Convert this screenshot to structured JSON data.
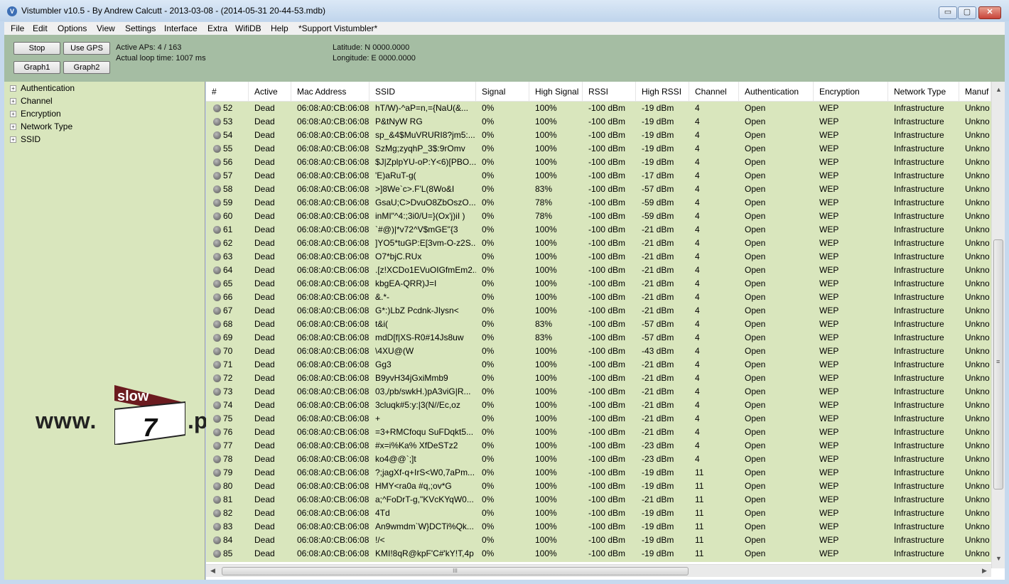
{
  "window": {
    "title": "Vistumbler v10.5 - By Andrew Calcutt - 2013-03-08 - (2014-05-31 20-44-53.mdb)",
    "controls": {
      "minimize": "▭",
      "maximize": "▢",
      "close": "✕"
    }
  },
  "menu": [
    "File",
    "Edit",
    "Options",
    "View",
    "Settings",
    "Interface",
    "Extra",
    "WifiDB",
    "Help",
    "*Support Vistumbler*"
  ],
  "toolbar": {
    "stop": "Stop",
    "use_gps": "Use GPS",
    "graph1": "Graph1",
    "graph2": "Graph2",
    "active_aps": "Active APs: 4 / 163",
    "loop_time": "Actual loop time: 1007 ms",
    "latitude": "Latitude: N 0000.0000",
    "longitude": "Longitude: E 0000.0000"
  },
  "tree": {
    "items": [
      "Authentication",
      "Channel",
      "Encryption",
      "Network Type",
      "SSID"
    ],
    "expander": "+"
  },
  "logo": {
    "prefix": "www.",
    "top": "slow",
    "number": "7",
    "suffix": ".pl"
  },
  "columns": [
    "#",
    "Active",
    "Mac Address",
    "SSID",
    "Signal",
    "High Signal",
    "RSSI",
    "High RSSI",
    "Channel",
    "Authentication",
    "Encryption",
    "Network Type",
    "Manuf"
  ],
  "rows": [
    [
      "52",
      "Dead",
      "06:08:A0:CB:06:08",
      "hT/W)-^aP=n,={NaU(&...",
      "0%",
      "100%",
      "-100 dBm",
      "-19 dBm",
      "4",
      "Open",
      "WEP",
      "Infrastructure",
      "Unkno"
    ],
    [
      "53",
      "Dead",
      "06:08:A0:CB:06:08",
      "P&tNyW RG",
      "0%",
      "100%",
      "-100 dBm",
      "-19 dBm",
      "4",
      "Open",
      "WEP",
      "Infrastructure",
      "Unkno"
    ],
    [
      "54",
      "Dead",
      "06:08:A0:CB:06:08",
      "sp_&4$MuVRURI8?jm5:...",
      "0%",
      "100%",
      "-100 dBm",
      "-19 dBm",
      "4",
      "Open",
      "WEP",
      "Infrastructure",
      "Unkno"
    ],
    [
      "55",
      "Dead",
      "06:08:A0:CB:06:08",
      "SzMg;zyqhP_3$:9rOmv",
      "0%",
      "100%",
      "-100 dBm",
      "-19 dBm",
      "4",
      "Open",
      "WEP",
      "Infrastructure",
      "Unkno"
    ],
    [
      "56",
      "Dead",
      "06:08:A0:CB:06:08",
      "$J|ZplpYU-oP:Y<6)[PBO...",
      "0%",
      "100%",
      "-100 dBm",
      "-19 dBm",
      "4",
      "Open",
      "WEP",
      "Infrastructure",
      "Unkno"
    ],
    [
      "57",
      "Dead",
      "06:08:A0:CB:06:08",
      "'E)aRuT-g(",
      "0%",
      "100%",
      "-100 dBm",
      "-17 dBm",
      "4",
      "Open",
      "WEP",
      "Infrastructure",
      "Unkno"
    ],
    [
      "58",
      "Dead",
      "06:08:A0:CB:06:08",
      ">]8We`c>.F'L(8Wo&I",
      "0%",
      "83%",
      "-100 dBm",
      "-57 dBm",
      "4",
      "Open",
      "WEP",
      "Infrastructure",
      "Unkno"
    ],
    [
      "59",
      "Dead",
      "06:08:A0:CB:06:08",
      "GsaU;C>DvuO8ZbOszO...",
      "0%",
      "78%",
      "-100 dBm",
      "-59 dBm",
      "4",
      "Open",
      "WEP",
      "Infrastructure",
      "Unkno"
    ],
    [
      "60",
      "Dead",
      "06:08:A0:CB:06:08",
      "inMI\"^4:;3i0/U=}(Ox'j)iI )",
      "0%",
      "78%",
      "-100 dBm",
      "-59 dBm",
      "4",
      "Open",
      "WEP",
      "Infrastructure",
      "Unkno"
    ],
    [
      "61",
      "Dead",
      "06:08:A0:CB:06:08",
      "`#@)|*v72^V$mGE\"{3",
      "0%",
      "100%",
      "-100 dBm",
      "-21 dBm",
      "4",
      "Open",
      "WEP",
      "Infrastructure",
      "Unkno"
    ],
    [
      "62",
      "Dead",
      "06:08:A0:CB:06:08",
      "]YO5*tuGP:E[3vm-O-z2S...",
      "0%",
      "100%",
      "-100 dBm",
      "-21 dBm",
      "4",
      "Open",
      "WEP",
      "Infrastructure",
      "Unkno"
    ],
    [
      "63",
      "Dead",
      "06:08:A0:CB:06:08",
      "O7*bjC.RUx",
      "0%",
      "100%",
      "-100 dBm",
      "-21 dBm",
      "4",
      "Open",
      "WEP",
      "Infrastructure",
      "Unkno"
    ],
    [
      "64",
      "Dead",
      "06:08:A0:CB:06:08",
      ".[z!XCDo1EVuOIGfmEm2...",
      "0%",
      "100%",
      "-100 dBm",
      "-21 dBm",
      "4",
      "Open",
      "WEP",
      "Infrastructure",
      "Unkno"
    ],
    [
      "65",
      "Dead",
      "06:08:A0:CB:06:08",
      "kbgEA-QRR)J=I",
      "0%",
      "100%",
      "-100 dBm",
      "-21 dBm",
      "4",
      "Open",
      "WEP",
      "Infrastructure",
      "Unkno"
    ],
    [
      "66",
      "Dead",
      "06:08:A0:CB:06:08",
      "&.*-",
      "0%",
      "100%",
      "-100 dBm",
      "-21 dBm",
      "4",
      "Open",
      "WEP",
      "Infrastructure",
      "Unkno"
    ],
    [
      "67",
      "Dead",
      "06:08:A0:CB:06:08",
      "G*:)LbZ Pcdnk-JIysn<",
      "0%",
      "100%",
      "-100 dBm",
      "-21 dBm",
      "4",
      "Open",
      "WEP",
      "Infrastructure",
      "Unkno"
    ],
    [
      "68",
      "Dead",
      "06:08:A0:CB:06:08",
      "t&i(",
      "0%",
      "83%",
      "-100 dBm",
      "-57 dBm",
      "4",
      "Open",
      "WEP",
      "Infrastructure",
      "Unkno"
    ],
    [
      "69",
      "Dead",
      "06:08:A0:CB:06:08",
      "mdD[f|XS-R0#14Js8uw",
      "0%",
      "83%",
      "-100 dBm",
      "-57 dBm",
      "4",
      "Open",
      "WEP",
      "Infrastructure",
      "Unkno"
    ],
    [
      "70",
      "Dead",
      "06:08:A0:CB:06:08",
      "\\4XU@(W",
      "0%",
      "100%",
      "-100 dBm",
      "-43 dBm",
      "4",
      "Open",
      "WEP",
      "Infrastructure",
      "Unkno"
    ],
    [
      "71",
      "Dead",
      "06:08:A0:CB:06:08",
      "Gg3",
      "0%",
      "100%",
      "-100 dBm",
      "-21 dBm",
      "4",
      "Open",
      "WEP",
      "Infrastructure",
      "Unkno"
    ],
    [
      "72",
      "Dead",
      "06:08:A0:CB:06:08",
      "B9yvH34jGxiMmb9",
      "0%",
      "100%",
      "-100 dBm",
      "-21 dBm",
      "4",
      "Open",
      "WEP",
      "Infrastructure",
      "Unkno"
    ],
    [
      "73",
      "Dead",
      "06:08:A0:CB:06:08",
      "03,/pb/swkH.)pA3viG|R...",
      "0%",
      "100%",
      "-100 dBm",
      "-21 dBm",
      "4",
      "Open",
      "WEP",
      "Infrastructure",
      "Unkno"
    ],
    [
      "74",
      "Dead",
      "06:08:A0:CB:06:08",
      "3cluqk#5:y:|3(N//Ec,oz",
      "0%",
      "100%",
      "-100 dBm",
      "-21 dBm",
      "4",
      "Open",
      "WEP",
      "Infrastructure",
      "Unkno"
    ],
    [
      "75",
      "Dead",
      "06:08:A0:CB:06:08",
      "+",
      "0%",
      "100%",
      "-100 dBm",
      "-21 dBm",
      "4",
      "Open",
      "WEP",
      "Infrastructure",
      "Unkno"
    ],
    [
      "76",
      "Dead",
      "06:08:A0:CB:06:08",
      "=3+RMCfoqu SuFDqkt5...",
      "0%",
      "100%",
      "-100 dBm",
      "-21 dBm",
      "4",
      "Open",
      "WEP",
      "Infrastructure",
      "Unkno"
    ],
    [
      "77",
      "Dead",
      "06:08:A0:CB:06:08",
      "#x=i%Ka% XfDeSTz2",
      "0%",
      "100%",
      "-100 dBm",
      "-23 dBm",
      "4",
      "Open",
      "WEP",
      "Infrastructure",
      "Unkno"
    ],
    [
      "78",
      "Dead",
      "06:08:A0:CB:06:08",
      "ko4@@`;]t",
      "0%",
      "100%",
      "-100 dBm",
      "-23 dBm",
      "4",
      "Open",
      "WEP",
      "Infrastructure",
      "Unkno"
    ],
    [
      "79",
      "Dead",
      "06:08:A0:CB:06:08",
      "?;jagXf-q+IrS<W0,7aPm...",
      "0%",
      "100%",
      "-100 dBm",
      "-19 dBm",
      "11",
      "Open",
      "WEP",
      "Infrastructure",
      "Unkno"
    ],
    [
      "80",
      "Dead",
      "06:08:A0:CB:06:08",
      "HMY<ra0a #q,;ov*G",
      "0%",
      "100%",
      "-100 dBm",
      "-19 dBm",
      "11",
      "Open",
      "WEP",
      "Infrastructure",
      "Unkno"
    ],
    [
      "81",
      "Dead",
      "06:08:A0:CB:06:08",
      "a;^FoDrT-g,\"KVcKYqW0...",
      "0%",
      "100%",
      "-100 dBm",
      "-21 dBm",
      "11",
      "Open",
      "WEP",
      "Infrastructure",
      "Unkno"
    ],
    [
      "82",
      "Dead",
      "06:08:A0:CB:06:08",
      "4Td",
      "0%",
      "100%",
      "-100 dBm",
      "-19 dBm",
      "11",
      "Open",
      "WEP",
      "Infrastructure",
      "Unkno"
    ],
    [
      "83",
      "Dead",
      "06:08:A0:CB:06:08",
      "An9wmdm`W}DCTi%Qk...",
      "0%",
      "100%",
      "-100 dBm",
      "-19 dBm",
      "11",
      "Open",
      "WEP",
      "Infrastructure",
      "Unkno"
    ],
    [
      "84",
      "Dead",
      "06:08:A0:CB:06:08",
      "!/<",
      "0%",
      "100%",
      "-100 dBm",
      "-19 dBm",
      "11",
      "Open",
      "WEP",
      "Infrastructure",
      "Unkno"
    ],
    [
      "85",
      "Dead",
      "06:08:A0:CB:06:08",
      "KMI!8qR@kpF'C#'kY!T,4p",
      "0%",
      "100%",
      "-100 dBm",
      "-19 dBm",
      "11",
      "Open",
      "WEP",
      "Infrastructure",
      "Unkno"
    ]
  ],
  "scroll": {
    "up": "▲",
    "down": "▼",
    "left": "◀",
    "right": "▶",
    "grip": "III",
    "vgrip": "≡"
  }
}
